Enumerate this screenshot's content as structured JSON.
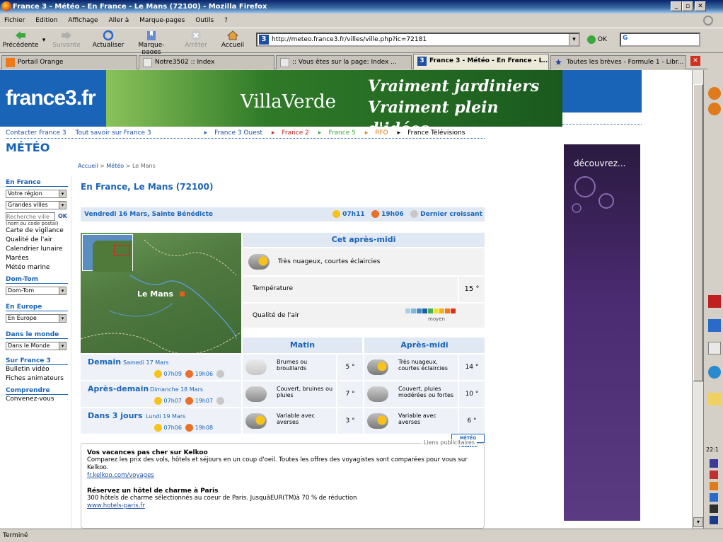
{
  "window": {
    "title": "France 3 - Météo - En France - Le Mans (72100) - Mozilla Firefox",
    "status": "Terminé"
  },
  "menu": [
    "Fichier",
    "Edition",
    "Affichage",
    "Aller à",
    "Marque-pages",
    "Outils",
    "?"
  ],
  "toolbar": {
    "back": "Précédente",
    "forward": "Suivante",
    "reload": "Actualiser",
    "bookmarks": "Marque-pages",
    "stop": "Arrêter",
    "home": "Accueil",
    "url": "http://meteo.france3.fr/villes/ville.php?ic=72181",
    "go": "OK"
  },
  "tabs": [
    {
      "label": "Portail Orange"
    },
    {
      "label": "Notre3502 :: Index"
    },
    {
      "label": ":: Vous êtes sur la page: Index ..."
    },
    {
      "label": "France 3 - Météo - En France - L..."
    },
    {
      "label": "Toutes les brèves - Formule 1 - Libr..."
    }
  ],
  "header": {
    "logo": "france3.fr",
    "banner_brand": "VillaVerde",
    "banner_slogan1": "Vraiment jardiniers",
    "banner_slogan2": "Vraiment plein d'idées",
    "topnav": [
      "Contacter France 3",
      "Tout savoir sur France 3",
      "France 3 Ouest",
      "France 2",
      "France 5",
      "RFO",
      "France Télévisions"
    ],
    "section_title": "MÉTÉO"
  },
  "sidebar": {
    "en_france": "En France",
    "sel_region": "Votre région",
    "sel_villes": "Grandes villes",
    "search_placeholder": "Recherche ville",
    "search_ok": "OK",
    "search_hint": "(nom ou code postal)",
    "links": [
      "Carte de vigilance",
      "Qualité de l'air",
      "Calendrier lunaire",
      "Marées",
      "Météo marine"
    ],
    "dom_tom": "Dom-Tom",
    "sel_domtom": "Dom-Tom",
    "en_europe": "En Europe",
    "sel_europe": "En Europe",
    "dans_monde": "Dans le monde",
    "sel_monde": "Dans le Monde",
    "sur_france3": "Sur France 3",
    "france3_links": [
      "Bulletin vidéo",
      "Fiches animateurs"
    ],
    "comprendre": "Comprendre",
    "comprendre_links": [
      "Convenez-vous"
    ]
  },
  "breadcrumb": [
    "Accueil",
    "Météo",
    "Le Mans"
  ],
  "city": "En France, Le Mans (72100)",
  "today": {
    "date": "Vendredi 16 Mars, Sainte Bénédicte",
    "sunrise": "07h11",
    "sunset": "19h06",
    "moon": "Dernier croissant"
  },
  "map": {
    "city_label": "Le Mans"
  },
  "afternoon": {
    "title": "Cet après-midi",
    "desc": "Très nuageux, courtes éclaircies",
    "temp_label": "Température",
    "temp_value": "15 °",
    "air_label": "Qualité de l'air",
    "air_scale_label": "moyen",
    "air_colors": [
      "#a8cfe8",
      "#7fb7de",
      "#3d8ac6",
      "#1d5fa5",
      "#4cae4c",
      "#f0e030",
      "#f7b01a",
      "#f07a1a",
      "#e0301a"
    ]
  },
  "forecast": {
    "col_morning": "Matin",
    "col_afternoon": "Après-midi",
    "days": [
      {
        "name": "Demain",
        "date": "Samedi 17 Mars",
        "sunrise": "07h09",
        "sunset": "19h06",
        "morning_desc": "Brumes ou brouillards",
        "morning_temp": "5 °",
        "afternoon_desc": "Très nuageux, courtes éclaircies",
        "afternoon_temp": "14 °"
      },
      {
        "name": "Après-demain",
        "date": "Dimanche 18 Mars",
        "sunrise": "07h07",
        "sunset": "19h07",
        "morning_desc": "Couvert, bruines ou pluies",
        "morning_temp": "7 °",
        "afternoon_desc": "Couvert, pluies modérées ou fortes",
        "afternoon_temp": "10 °"
      },
      {
        "name": "Dans 3 jours",
        "date": "Lundi 19 Mars",
        "sunrise": "07h06",
        "sunset": "19h08",
        "morning_desc": "Variable avec averses",
        "morning_temp": "3 °",
        "afternoon_desc": "Variable avec averses",
        "afternoon_temp": "6 °"
      }
    ]
  },
  "meteofrance_logo": "MÉTÉO FRANCE",
  "ads": {
    "label": "Liens publicitaires",
    "items": [
      {
        "title": "Vos vacances pas cher sur Kelkoo",
        "text": "Comparez les prix des vols, hôtels et séjours en un coup d'oeil. Toutes les offres des voyagistes sont comparées pour vous sur Kelkoo.",
        "url": "fr.kelkoo.com/voyages"
      },
      {
        "title": "Réservez un hôtel de charme à Paris",
        "text": "300 hôtels de charme sélectionnés au coeur de Paris. JusquâEUR(TM)à 70 % de réduction",
        "url": "www.hotels-paris.fr"
      }
    ],
    "right_banner": "découvrez..."
  },
  "right_strip": {
    "counter": "22:1"
  }
}
